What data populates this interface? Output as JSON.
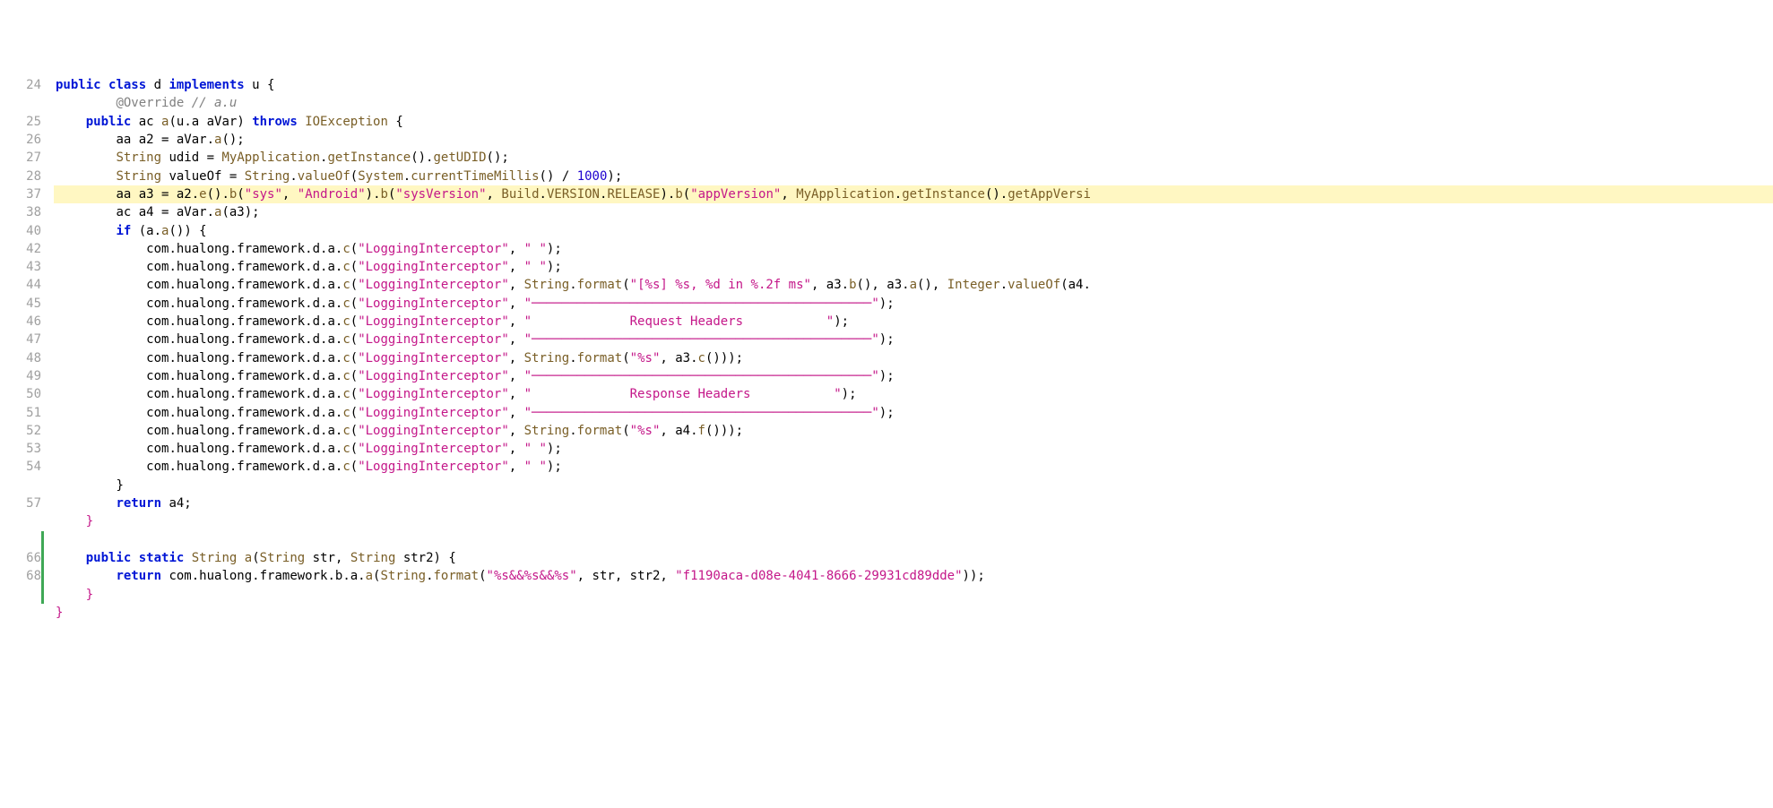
{
  "lines": [
    {
      "num": "24",
      "indent": 0,
      "segments": [
        {
          "t": "public ",
          "c": "kw"
        },
        {
          "t": "class ",
          "c": "kw"
        },
        {
          "t": "d ",
          "c": ""
        },
        {
          "t": "implements ",
          "c": "kw"
        },
        {
          "t": "u ",
          "c": ""
        },
        {
          "t": "{",
          "c": ""
        }
      ]
    },
    {
      "num": "",
      "indent": 8,
      "segments": [
        {
          "t": "@Override ",
          "c": "ann"
        },
        {
          "t": "// a.u",
          "c": "cmt"
        }
      ]
    },
    {
      "num": "25",
      "indent": 4,
      "segments": [
        {
          "t": "public ",
          "c": "kw"
        },
        {
          "t": "ac ",
          "c": ""
        },
        {
          "t": "a",
          "c": "type"
        },
        {
          "t": "(u.a aVar) ",
          "c": ""
        },
        {
          "t": "throws ",
          "c": "kw"
        },
        {
          "t": "IOException ",
          "c": "type"
        },
        {
          "t": "{",
          "c": ""
        }
      ]
    },
    {
      "num": "26",
      "indent": 8,
      "segments": [
        {
          "t": "aa a2 = aVar.",
          "c": ""
        },
        {
          "t": "a",
          "c": "type"
        },
        {
          "t": "();",
          "c": ""
        }
      ]
    },
    {
      "num": "27",
      "indent": 8,
      "segments": [
        {
          "t": "String ",
          "c": "type"
        },
        {
          "t": "udid = ",
          "c": ""
        },
        {
          "t": "MyApplication",
          "c": "type"
        },
        {
          "t": ".",
          "c": ""
        },
        {
          "t": "getInstance",
          "c": "type"
        },
        {
          "t": "().",
          "c": ""
        },
        {
          "t": "getUDID",
          "c": "type"
        },
        {
          "t": "();",
          "c": ""
        }
      ]
    },
    {
      "num": "28",
      "indent": 8,
      "segments": [
        {
          "t": "String ",
          "c": "type"
        },
        {
          "t": "valueOf = ",
          "c": ""
        },
        {
          "t": "String",
          "c": "type"
        },
        {
          "t": ".",
          "c": ""
        },
        {
          "t": "valueOf",
          "c": "type"
        },
        {
          "t": "(",
          "c": ""
        },
        {
          "t": "System",
          "c": "type"
        },
        {
          "t": ".",
          "c": ""
        },
        {
          "t": "currentTimeMillis",
          "c": "type"
        },
        {
          "t": "() / ",
          "c": ""
        },
        {
          "t": "1000",
          "c": "num"
        },
        {
          "t": ");",
          "c": ""
        }
      ]
    },
    {
      "num": "37",
      "hl": true,
      "indent": 8,
      "segments": [
        {
          "t": "aa a3 = a2.",
          "c": ""
        },
        {
          "t": "e",
          "c": "type"
        },
        {
          "t": "().",
          "c": ""
        },
        {
          "t": "b",
          "c": "type"
        },
        {
          "t": "(",
          "c": ""
        },
        {
          "t": "\"sys\"",
          "c": "str"
        },
        {
          "t": ", ",
          "c": ""
        },
        {
          "t": "\"Android\"",
          "c": "str"
        },
        {
          "t": ").",
          "c": ""
        },
        {
          "t": "b",
          "c": "type"
        },
        {
          "t": "(",
          "c": ""
        },
        {
          "t": "\"sysVersion\"",
          "c": "str"
        },
        {
          "t": ", ",
          "c": ""
        },
        {
          "t": "Build",
          "c": "type"
        },
        {
          "t": ".",
          "c": ""
        },
        {
          "t": "VERSION",
          "c": "type"
        },
        {
          "t": ".",
          "c": ""
        },
        {
          "t": "RELEASE",
          "c": "type"
        },
        {
          "t": ").",
          "c": ""
        },
        {
          "t": "b",
          "c": "type"
        },
        {
          "t": "(",
          "c": ""
        },
        {
          "t": "\"appVersion\"",
          "c": "str"
        },
        {
          "t": ", ",
          "c": ""
        },
        {
          "t": "MyApplication",
          "c": "type"
        },
        {
          "t": ".",
          "c": ""
        },
        {
          "t": "getInstance",
          "c": "type"
        },
        {
          "t": "().",
          "c": ""
        },
        {
          "t": "getAppVersi",
          "c": "type"
        }
      ]
    },
    {
      "num": "38",
      "indent": 8,
      "segments": [
        {
          "t": "ac a4 = aVar.",
          "c": ""
        },
        {
          "t": "a",
          "c": "type"
        },
        {
          "t": "(a3);",
          "c": ""
        }
      ]
    },
    {
      "num": "40",
      "indent": 8,
      "segments": [
        {
          "t": "if ",
          "c": "kw"
        },
        {
          "t": "(a.",
          "c": ""
        },
        {
          "t": "a",
          "c": "type"
        },
        {
          "t": "()) {",
          "c": ""
        }
      ]
    },
    {
      "num": "42",
      "indent": 12,
      "segments": [
        {
          "t": "com.hualong.framework.d.a.",
          "c": ""
        },
        {
          "t": "c",
          "c": "type"
        },
        {
          "t": "(",
          "c": ""
        },
        {
          "t": "\"LoggingInterceptor\"",
          "c": "str"
        },
        {
          "t": ", ",
          "c": ""
        },
        {
          "t": "\" \"",
          "c": "str"
        },
        {
          "t": ");",
          "c": ""
        }
      ]
    },
    {
      "num": "43",
      "indent": 12,
      "segments": [
        {
          "t": "com.hualong.framework.d.a.",
          "c": ""
        },
        {
          "t": "c",
          "c": "type"
        },
        {
          "t": "(",
          "c": ""
        },
        {
          "t": "\"LoggingInterceptor\"",
          "c": "str"
        },
        {
          "t": ", ",
          "c": ""
        },
        {
          "t": "\" \"",
          "c": "str"
        },
        {
          "t": ");",
          "c": ""
        }
      ]
    },
    {
      "num": "44",
      "indent": 12,
      "segments": [
        {
          "t": "com.hualong.framework.d.a.",
          "c": ""
        },
        {
          "t": "c",
          "c": "type"
        },
        {
          "t": "(",
          "c": ""
        },
        {
          "t": "\"LoggingInterceptor\"",
          "c": "str"
        },
        {
          "t": ", ",
          "c": ""
        },
        {
          "t": "String",
          "c": "type"
        },
        {
          "t": ".",
          "c": ""
        },
        {
          "t": "format",
          "c": "type"
        },
        {
          "t": "(",
          "c": ""
        },
        {
          "t": "\"[%s] %s, %d in %.2f ms\"",
          "c": "str"
        },
        {
          "t": ", a3.",
          "c": ""
        },
        {
          "t": "b",
          "c": "type"
        },
        {
          "t": "(), a3.",
          "c": ""
        },
        {
          "t": "a",
          "c": "type"
        },
        {
          "t": "(), ",
          "c": ""
        },
        {
          "t": "Integer",
          "c": "type"
        },
        {
          "t": ".",
          "c": ""
        },
        {
          "t": "valueOf",
          "c": "type"
        },
        {
          "t": "(a4.",
          "c": ""
        }
      ]
    },
    {
      "num": "45",
      "indent": 12,
      "segments": [
        {
          "t": "com.hualong.framework.d.a.",
          "c": ""
        },
        {
          "t": "c",
          "c": "type"
        },
        {
          "t": "(",
          "c": ""
        },
        {
          "t": "\"LoggingInterceptor\"",
          "c": "str"
        },
        {
          "t": ", ",
          "c": ""
        },
        {
          "t": "\"─────────────────────────────────────────────\"",
          "c": "str"
        },
        {
          "t": ");",
          "c": ""
        }
      ]
    },
    {
      "num": "46",
      "indent": 12,
      "segments": [
        {
          "t": "com.hualong.framework.d.a.",
          "c": ""
        },
        {
          "t": "c",
          "c": "type"
        },
        {
          "t": "(",
          "c": ""
        },
        {
          "t": "\"LoggingInterceptor\"",
          "c": "str"
        },
        {
          "t": ", ",
          "c": ""
        },
        {
          "t": "\"             Request Headers           \"",
          "c": "str"
        },
        {
          "t": ");",
          "c": ""
        }
      ]
    },
    {
      "num": "47",
      "indent": 12,
      "segments": [
        {
          "t": "com.hualong.framework.d.a.",
          "c": ""
        },
        {
          "t": "c",
          "c": "type"
        },
        {
          "t": "(",
          "c": ""
        },
        {
          "t": "\"LoggingInterceptor\"",
          "c": "str"
        },
        {
          "t": ", ",
          "c": ""
        },
        {
          "t": "\"─────────────────────────────────────────────\"",
          "c": "str"
        },
        {
          "t": ");",
          "c": ""
        }
      ]
    },
    {
      "num": "48",
      "indent": 12,
      "segments": [
        {
          "t": "com.hualong.framework.d.a.",
          "c": ""
        },
        {
          "t": "c",
          "c": "type"
        },
        {
          "t": "(",
          "c": ""
        },
        {
          "t": "\"LoggingInterceptor\"",
          "c": "str"
        },
        {
          "t": ", ",
          "c": ""
        },
        {
          "t": "String",
          "c": "type"
        },
        {
          "t": ".",
          "c": ""
        },
        {
          "t": "format",
          "c": "type"
        },
        {
          "t": "(",
          "c": ""
        },
        {
          "t": "\"%s\"",
          "c": "str"
        },
        {
          "t": ", a3.",
          "c": ""
        },
        {
          "t": "c",
          "c": "type"
        },
        {
          "t": "()));",
          "c": ""
        }
      ]
    },
    {
      "num": "49",
      "indent": 12,
      "segments": [
        {
          "t": "com.hualong.framework.d.a.",
          "c": ""
        },
        {
          "t": "c",
          "c": "type"
        },
        {
          "t": "(",
          "c": ""
        },
        {
          "t": "\"LoggingInterceptor\"",
          "c": "str"
        },
        {
          "t": ", ",
          "c": ""
        },
        {
          "t": "\"─────────────────────────────────────────────\"",
          "c": "str"
        },
        {
          "t": ");",
          "c": ""
        }
      ]
    },
    {
      "num": "50",
      "indent": 12,
      "segments": [
        {
          "t": "com.hualong.framework.d.a.",
          "c": ""
        },
        {
          "t": "c",
          "c": "type"
        },
        {
          "t": "(",
          "c": ""
        },
        {
          "t": "\"LoggingInterceptor\"",
          "c": "str"
        },
        {
          "t": ", ",
          "c": ""
        },
        {
          "t": "\"             Response Headers           \"",
          "c": "str"
        },
        {
          "t": ");",
          "c": ""
        }
      ]
    },
    {
      "num": "51",
      "indent": 12,
      "segments": [
        {
          "t": "com.hualong.framework.d.a.",
          "c": ""
        },
        {
          "t": "c",
          "c": "type"
        },
        {
          "t": "(",
          "c": ""
        },
        {
          "t": "\"LoggingInterceptor\"",
          "c": "str"
        },
        {
          "t": ", ",
          "c": ""
        },
        {
          "t": "\"─────────────────────────────────────────────\"",
          "c": "str"
        },
        {
          "t": ");",
          "c": ""
        }
      ]
    },
    {
      "num": "52",
      "indent": 12,
      "segments": [
        {
          "t": "com.hualong.framework.d.a.",
          "c": ""
        },
        {
          "t": "c",
          "c": "type"
        },
        {
          "t": "(",
          "c": ""
        },
        {
          "t": "\"LoggingInterceptor\"",
          "c": "str"
        },
        {
          "t": ", ",
          "c": ""
        },
        {
          "t": "String",
          "c": "type"
        },
        {
          "t": ".",
          "c": ""
        },
        {
          "t": "format",
          "c": "type"
        },
        {
          "t": "(",
          "c": ""
        },
        {
          "t": "\"%s\"",
          "c": "str"
        },
        {
          "t": ", a4.",
          "c": ""
        },
        {
          "t": "f",
          "c": "type"
        },
        {
          "t": "()));",
          "c": ""
        }
      ]
    },
    {
      "num": "53",
      "indent": 12,
      "segments": [
        {
          "t": "com.hualong.framework.d.a.",
          "c": ""
        },
        {
          "t": "c",
          "c": "type"
        },
        {
          "t": "(",
          "c": ""
        },
        {
          "t": "\"LoggingInterceptor\"",
          "c": "str"
        },
        {
          "t": ", ",
          "c": ""
        },
        {
          "t": "\" \"",
          "c": "str"
        },
        {
          "t": ");",
          "c": ""
        }
      ]
    },
    {
      "num": "54",
      "indent": 12,
      "segments": [
        {
          "t": "com.hualong.framework.d.a.",
          "c": ""
        },
        {
          "t": "c",
          "c": "type"
        },
        {
          "t": "(",
          "c": ""
        },
        {
          "t": "\"LoggingInterceptor\"",
          "c": "str"
        },
        {
          "t": ", ",
          "c": ""
        },
        {
          "t": "\" \"",
          "c": "str"
        },
        {
          "t": ");",
          "c": ""
        }
      ]
    },
    {
      "num": "",
      "indent": 8,
      "segments": [
        {
          "t": "}",
          "c": ""
        }
      ]
    },
    {
      "num": "57",
      "indent": 8,
      "segments": [
        {
          "t": "return ",
          "c": "kw"
        },
        {
          "t": "a4;",
          "c": ""
        }
      ]
    },
    {
      "num": "",
      "indent": 4,
      "segments": [
        {
          "t": "}",
          "c": "str"
        }
      ]
    },
    {
      "num": "",
      "indent": 0,
      "blank": true,
      "mod": true,
      "segments": []
    },
    {
      "num": "66",
      "indent": 4,
      "mod": true,
      "segments": [
        {
          "t": "public ",
          "c": "kw"
        },
        {
          "t": "static ",
          "c": "kw"
        },
        {
          "t": "String ",
          "c": "type"
        },
        {
          "t": "a",
          "c": "type"
        },
        {
          "t": "(",
          "c": ""
        },
        {
          "t": "String ",
          "c": "type"
        },
        {
          "t": "str, ",
          "c": ""
        },
        {
          "t": "String ",
          "c": "type"
        },
        {
          "t": "str2) {",
          "c": ""
        }
      ]
    },
    {
      "num": "68",
      "indent": 8,
      "mod": true,
      "segments": [
        {
          "t": "return ",
          "c": "kw"
        },
        {
          "t": "com.hualong.framework.b.a.",
          "c": ""
        },
        {
          "t": "a",
          "c": "type"
        },
        {
          "t": "(",
          "c": ""
        },
        {
          "t": "String",
          "c": "type"
        },
        {
          "t": ".",
          "c": ""
        },
        {
          "t": "format",
          "c": "type"
        },
        {
          "t": "(",
          "c": ""
        },
        {
          "t": "\"%s&&%s&&%s\"",
          "c": "str"
        },
        {
          "t": ", str, str2, ",
          "c": ""
        },
        {
          "t": "\"f1190aca-d08e-4041-8666-29931cd89dde\"",
          "c": "str"
        },
        {
          "t": "));",
          "c": ""
        }
      ]
    },
    {
      "num": "",
      "indent": 4,
      "mod": true,
      "segments": [
        {
          "t": "}",
          "c": "str"
        }
      ]
    },
    {
      "num": "",
      "indent": 0,
      "segments": [
        {
          "t": "}",
          "c": "str"
        }
      ]
    }
  ]
}
